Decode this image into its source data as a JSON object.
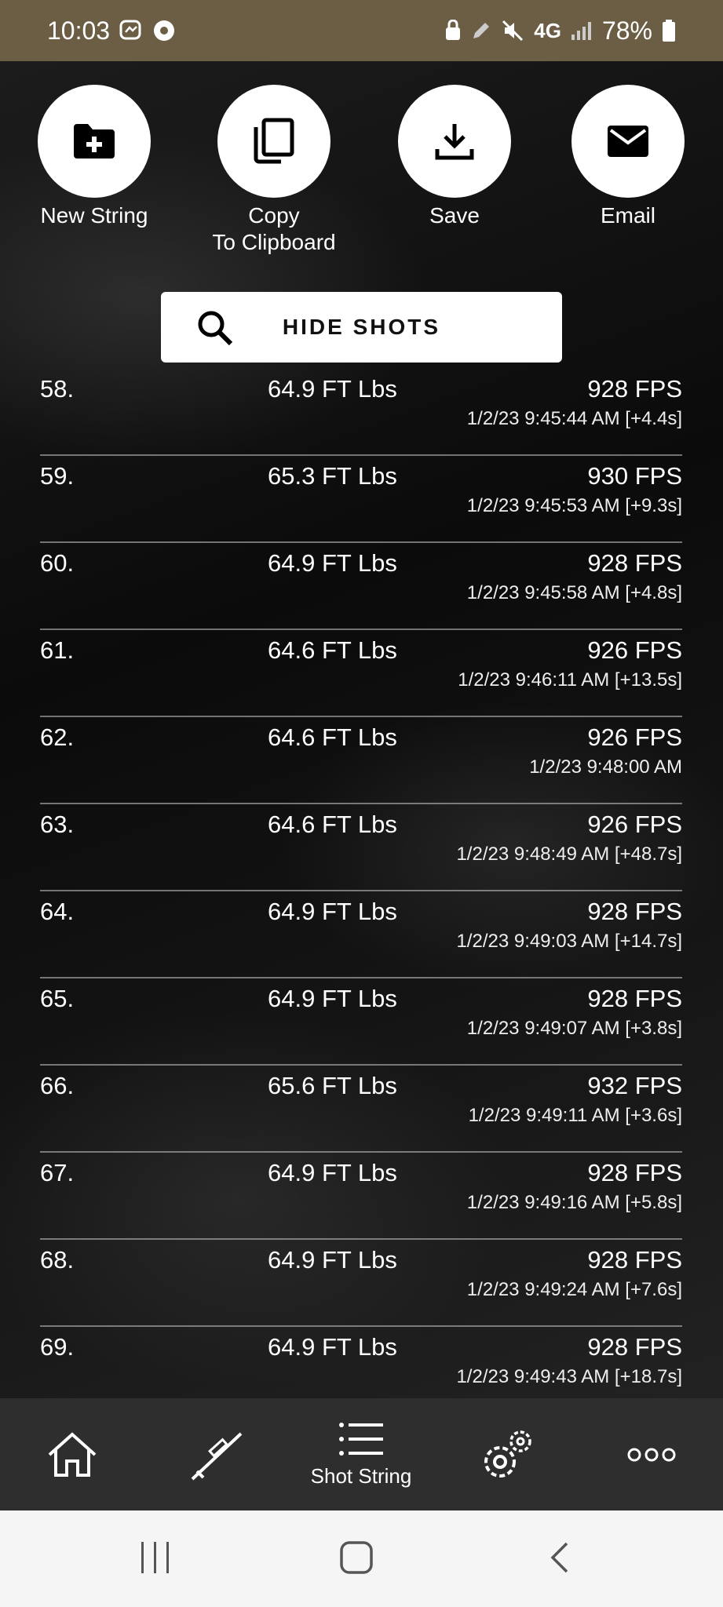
{
  "status_bar": {
    "time": "10:03",
    "battery": "78%",
    "network": "4G"
  },
  "actions": [
    {
      "label": "New String",
      "icon": "folder-plus-icon"
    },
    {
      "label": "Copy\nTo Clipboard",
      "icon": "copy-icon"
    },
    {
      "label": "Save",
      "icon": "download-icon"
    },
    {
      "label": "Email",
      "icon": "mail-icon"
    }
  ],
  "hide_shots": {
    "label": "HIDE SHOTS"
  },
  "shots": [
    {
      "num": "58.",
      "energy": "64.9 FT Lbs",
      "fps": "928 FPS",
      "time": "1/2/23 9:45:44 AM [+4.4s]"
    },
    {
      "num": "59.",
      "energy": "65.3 FT Lbs",
      "fps": "930 FPS",
      "time": "1/2/23 9:45:53 AM [+9.3s]"
    },
    {
      "num": "60.",
      "energy": "64.9 FT Lbs",
      "fps": "928 FPS",
      "time": "1/2/23 9:45:58 AM [+4.8s]"
    },
    {
      "num": "61.",
      "energy": "64.6 FT Lbs",
      "fps": "926 FPS",
      "time": "1/2/23 9:46:11 AM [+13.5s]"
    },
    {
      "num": "62.",
      "energy": "64.6 FT Lbs",
      "fps": "926 FPS",
      "time": "1/2/23 9:48:00 AM"
    },
    {
      "num": "63.",
      "energy": "64.6 FT Lbs",
      "fps": "926 FPS",
      "time": "1/2/23 9:48:49 AM [+48.7s]"
    },
    {
      "num": "64.",
      "energy": "64.9 FT Lbs",
      "fps": "928 FPS",
      "time": "1/2/23 9:49:03 AM [+14.7s]"
    },
    {
      "num": "65.",
      "energy": "64.9 FT Lbs",
      "fps": "928 FPS",
      "time": "1/2/23 9:49:07 AM [+3.8s]"
    },
    {
      "num": "66.",
      "energy": "65.6 FT Lbs",
      "fps": "932 FPS",
      "time": "1/2/23 9:49:11 AM [+3.6s]"
    },
    {
      "num": "67.",
      "energy": "64.9 FT Lbs",
      "fps": "928 FPS",
      "time": "1/2/23 9:49:16 AM [+5.8s]"
    },
    {
      "num": "68.",
      "energy": "64.9 FT Lbs",
      "fps": "928 FPS",
      "time": "1/2/23 9:49:24 AM [+7.6s]"
    },
    {
      "num": "69.",
      "energy": "64.9 FT Lbs",
      "fps": "928 FPS",
      "time": "1/2/23 9:49:43 AM [+18.7s]"
    }
  ],
  "bottom_nav": {
    "items": [
      {
        "icon": "home-icon"
      },
      {
        "icon": "rifle-icon"
      },
      {
        "icon": "list-icon",
        "label": "Shot String"
      },
      {
        "icon": "gear-icon"
      },
      {
        "icon": "more-icon"
      }
    ]
  },
  "system_nav": {
    "icons": [
      "recent-apps-icon",
      "home-button-icon",
      "back-icon"
    ]
  }
}
